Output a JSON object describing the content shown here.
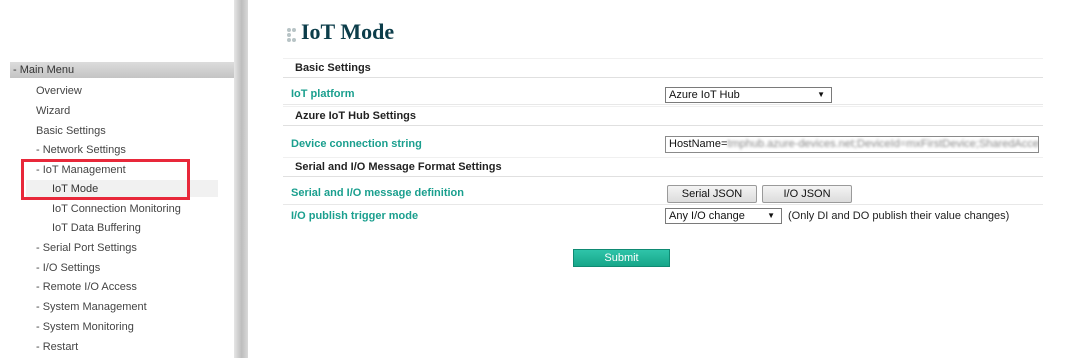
{
  "page": {
    "title": "IoT Mode"
  },
  "sidebar": {
    "header": "- Main Menu",
    "items": [
      {
        "label": "Overview"
      },
      {
        "label": "Wizard"
      },
      {
        "label": "Basic Settings"
      },
      {
        "label": "- Network Settings"
      },
      {
        "label": "- IoT Management"
      },
      {
        "label": "IoT Mode",
        "active": true
      },
      {
        "label": "IoT Connection Monitoring"
      },
      {
        "label": "IoT Data Buffering"
      },
      {
        "label": "- Serial Port Settings"
      },
      {
        "label": "- I/O Settings"
      },
      {
        "label": "- Remote I/O Access"
      },
      {
        "label": "- System Management"
      },
      {
        "label": "- System Monitoring"
      },
      {
        "label": "- Restart"
      }
    ]
  },
  "sections": {
    "basic_settings": "Basic Settings",
    "azure_settings": "Azure IoT Hub Settings",
    "serial_io_settings": "Serial and I/O Message Format Settings"
  },
  "fields": {
    "iot_platform": {
      "label": "IoT platform",
      "value": "Azure IoT Hub"
    },
    "device_connection": {
      "label": "Device connection string",
      "value_visible": "HostName=",
      "value_blurred": "tmphub.azure-devices.net;DeviceId=mxFirstDevice;SharedAccess"
    },
    "message_definition": {
      "label": "Serial and I/O message definition",
      "serial_button": "Serial JSON",
      "io_button": "I/O JSON"
    },
    "publish_trigger": {
      "label": "I/O publish trigger mode",
      "value": "Any I/O change",
      "note": "(Only DI and DO publish their value changes)"
    }
  },
  "actions": {
    "submit": "Submit"
  },
  "colors": {
    "accent": "#1a9f8e",
    "submit": "#1fb597",
    "highlight": "#e8283a",
    "title": "#0c3d4a"
  }
}
